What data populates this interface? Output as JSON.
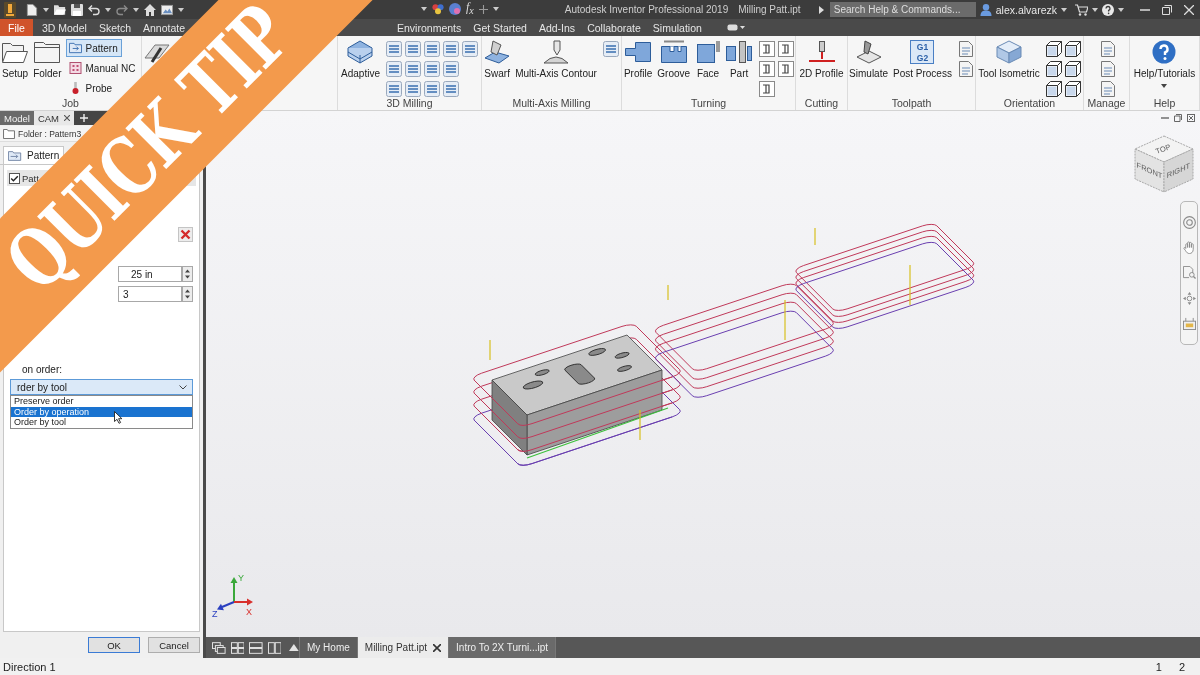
{
  "title_bar": {
    "formula_glyph": "f$_{x}$",
    "title": "Autodesk Inventor Professional 2019",
    "document": "Milling Patt.ipt",
    "search": {
      "placeholder": "Search Help & Commands..."
    },
    "user": "alex.alvarezk"
  },
  "menu_tabs": [
    {
      "label": "File",
      "kind": "file",
      "selected": false
    },
    {
      "label": "3D Model",
      "kind": "tab",
      "selected": false
    },
    {
      "label": "Sketch",
      "kind": "tab",
      "selected": false
    },
    {
      "label": "Annotate",
      "kind": "tab",
      "selected": false
    },
    {
      "label": "Environments",
      "kind": "tab",
      "selected": false
    },
    {
      "label": "Get Started",
      "kind": "tab",
      "selected": false
    },
    {
      "label": "Add-Ins",
      "kind": "tab",
      "selected": false
    },
    {
      "label": "Collaborate",
      "kind": "tab",
      "selected": false
    },
    {
      "label": "Simulation",
      "kind": "tab",
      "selected": false
    }
  ],
  "ribbon": [
    {
      "title": "Job",
      "tools": [
        {
          "kind": "large",
          "label": "Setup"
        },
        {
          "kind": "large",
          "label": "Folder"
        },
        {
          "kind": "stack",
          "items": [
            {
              "label": "Pattern",
              "selected": true
            },
            {
              "label": "Manual NC",
              "selected": false
            },
            {
              "label": "Probe",
              "selected": false
            }
          ]
        }
      ]
    },
    {
      "tools": [
        {
          "kind": "large"
        }
      ]
    },
    {
      "title": "3D Milling",
      "tools": [
        {
          "kind": "large",
          "label": "Adaptive"
        },
        {
          "kind": "small"
        },
        {
          "kind": "small"
        },
        {
          "kind": "small"
        },
        {
          "kind": "small"
        },
        {
          "kind": "small"
        },
        {
          "kind": "small"
        },
        {
          "kind": "small"
        },
        {
          "kind": "small"
        },
        {
          "kind": "small"
        },
        {
          "kind": "small"
        },
        {
          "kind": "small"
        },
        {
          "kind": "small"
        },
        {
          "kind": "small"
        }
      ]
    },
    {
      "title": "Multi-Axis Milling",
      "tools": [
        {
          "kind": "large",
          "label": "Swarf"
        },
        {
          "kind": "large",
          "label": "Multi-Axis Contour"
        },
        {
          "kind": "small"
        }
      ]
    },
    {
      "title": "Turning",
      "tools": [
        {
          "kind": "large",
          "label": "Profile"
        },
        {
          "kind": "large",
          "label": "Groove"
        },
        {
          "kind": "large",
          "label": "Face"
        },
        {
          "kind": "large",
          "label": "Part"
        },
        {
          "kind": "small"
        },
        {
          "kind": "small"
        },
        {
          "kind": "small"
        },
        {
          "kind": "small"
        },
        {
          "kind": "small"
        }
      ]
    },
    {
      "title": "Cutting",
      "tools": [
        {
          "kind": "large",
          "label": "2D Profile"
        }
      ]
    },
    {
      "title": "Toolpath",
      "tools": [
        {
          "kind": "large",
          "label": "Simulate"
        },
        {
          "kind": "large",
          "label": "Post Process",
          "icon_text": [
            "G1",
            "G2"
          ]
        },
        {
          "kind": "small"
        },
        {
          "kind": "small"
        }
      ]
    },
    {
      "title": "Orientation",
      "tools": [
        {
          "kind": "large",
          "label": "Tool Isometric"
        },
        {
          "kind": "small"
        },
        {
          "kind": "small"
        },
        {
          "kind": "small"
        },
        {
          "kind": "small"
        },
        {
          "kind": "small"
        },
        {
          "kind": "small"
        }
      ]
    },
    {
      "title": "Manage",
      "tools": [
        {
          "kind": "small"
        },
        {
          "kind": "small"
        },
        {
          "kind": "small"
        }
      ]
    },
    {
      "title": "Help",
      "tools": [
        {
          "kind": "large",
          "label": "Help/Tutorials",
          "menu": true
        }
      ]
    }
  ],
  "browser": {
    "tabs": [
      {
        "label": "Model",
        "selected": false
      },
      {
        "label": "CAM",
        "selected": true
      }
    ],
    "path": "Folder : Pattern3"
  },
  "dialog": {
    "tabs": [
      {
        "label": "Pattern",
        "selected": true
      }
    ],
    "group": {
      "title": "Patt",
      "checked": true
    },
    "fields": [
      {
        "value": "25 in"
      },
      {
        "value": "3"
      }
    ],
    "order_label": "on order:",
    "dropdown": {
      "value": "rder by tool",
      "expanded": true,
      "options": [
        {
          "label": "Preserve order",
          "selected": false
        },
        {
          "label": "Order by operation",
          "selected": true
        },
        {
          "label": "Order by tool",
          "selected": false
        }
      ]
    },
    "buttons": [
      {
        "label": "OK",
        "kind": "default"
      },
      {
        "label": "Cancel",
        "kind": "normal"
      }
    ]
  },
  "viewport": {
    "view_cube": {
      "faces": [
        "TOP",
        "FRONT",
        "RIGHT"
      ]
    },
    "axes": [
      {
        "label": "Y",
        "color": "#3aa83a"
      },
      {
        "label": "Z",
        "color": "#2a3fc0"
      },
      {
        "label": "X",
        "color": "#d8302c"
      }
    ]
  },
  "document_tabs": [
    {
      "label": "My Home",
      "selected": false
    },
    {
      "label": "Milling Patt.ipt",
      "selected": true
    },
    {
      "label": "Intro To 2X Turni...ipt",
      "selected": false
    }
  ],
  "status_bar": {
    "message": "Direction 1",
    "pages": [
      "1",
      "2"
    ]
  },
  "banner": {
    "text": "QUICK TIP"
  }
}
